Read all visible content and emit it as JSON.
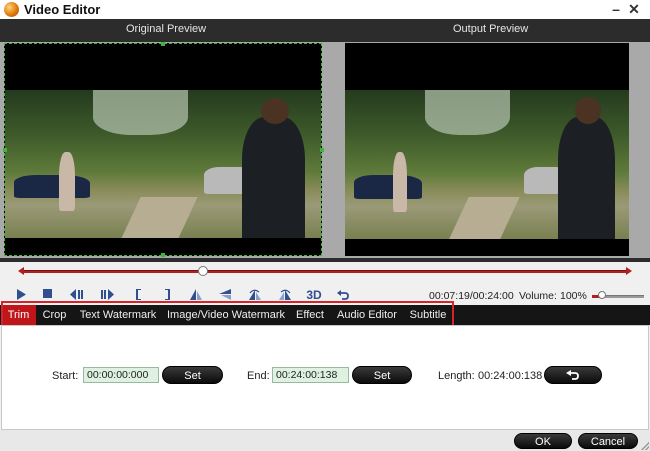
{
  "window": {
    "title": "Video Editor",
    "minimize_symbol": "–",
    "close_symbol": "✕"
  },
  "preview": {
    "original_label": "Original Preview",
    "output_label": "Output Preview"
  },
  "playback": {
    "position_fraction": 0.3,
    "time_readout": "00:07:19/00:24:00",
    "controls": [
      {
        "name": "play-icon",
        "glyph": "▶"
      },
      {
        "name": "stop-icon",
        "glyph": "■"
      },
      {
        "name": "prev-frame-icon",
        "glyph": "◁▏"
      },
      {
        "name": "next-frame-icon",
        "glyph": "▕▷"
      },
      {
        "name": "mark-in-icon",
        "glyph": "["
      },
      {
        "name": "mark-out-icon",
        "glyph": "]"
      },
      {
        "name": "flip-vertical-icon",
        "glyph": "▲"
      },
      {
        "name": "flip-horizontal-icon",
        "glyph": "◀"
      },
      {
        "name": "rotate-left-icon",
        "glyph": "◭"
      },
      {
        "name": "rotate-right-icon",
        "glyph": "◮"
      },
      {
        "name": "3d-button",
        "glyph": "3D"
      },
      {
        "name": "undo-icon",
        "glyph": "↶"
      }
    ],
    "volume_label": "Volume:",
    "volume_value": "100%",
    "volume_fraction": 0.2
  },
  "tabs": [
    {
      "label": "Trim",
      "active": true
    },
    {
      "label": "Crop",
      "active": false
    },
    {
      "label": "Text Watermark",
      "active": false
    },
    {
      "label": "Image/Video Watermark",
      "active": false
    },
    {
      "label": "Effect",
      "active": false
    },
    {
      "label": "Audio Editor",
      "active": false
    },
    {
      "label": "Subtitle",
      "active": false
    }
  ],
  "trim": {
    "start_label": "Start:",
    "start_value": "00:00:00:000",
    "set_label": "Set",
    "end_label": "End:",
    "end_value": "00:24:00:138",
    "length_label": "Length:",
    "length_value": "00:24:00:138",
    "reset_icon": "undo-icon"
  },
  "footer": {
    "ok_label": "OK",
    "cancel_label": "Cancel"
  },
  "colors": {
    "accent": "#c0161a",
    "tabbar": "#151515",
    "time_input_bg": "#dff2e1"
  }
}
